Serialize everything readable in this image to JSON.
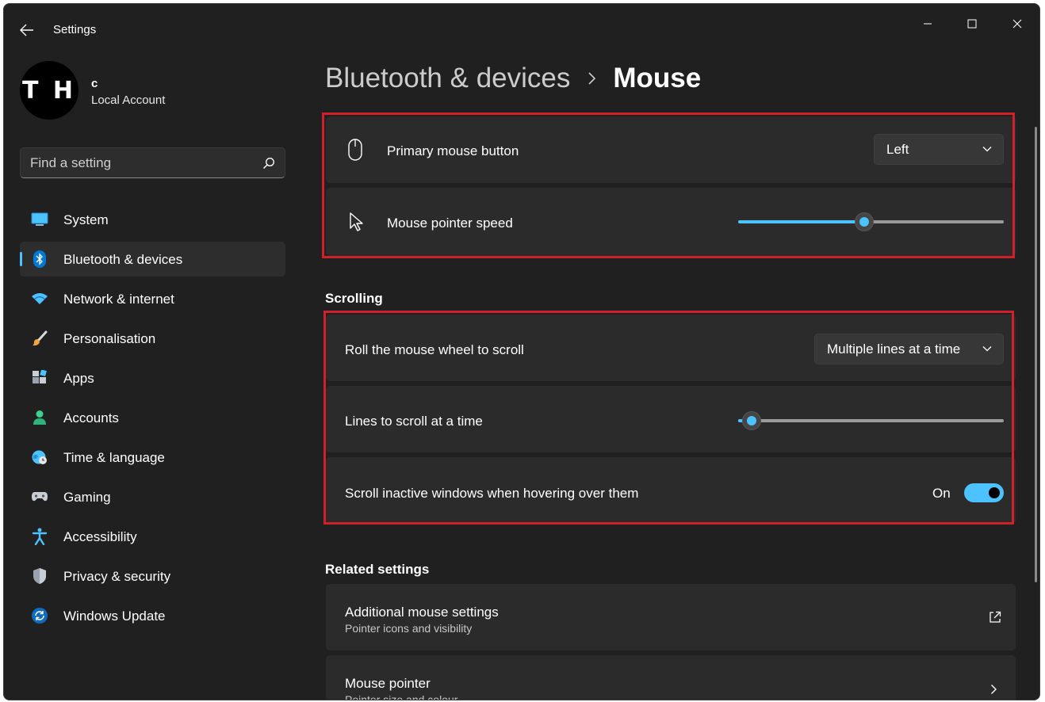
{
  "window": {
    "title": "Settings"
  },
  "profile": {
    "initials": "T H",
    "name": "c",
    "account_type": "Local Account"
  },
  "search": {
    "placeholder": "Find a setting"
  },
  "nav": {
    "items": [
      {
        "label": "System",
        "icon": "monitor-icon"
      },
      {
        "label": "Bluetooth & devices",
        "icon": "bluetooth-icon",
        "active": true
      },
      {
        "label": "Network & internet",
        "icon": "wifi-icon"
      },
      {
        "label": "Personalisation",
        "icon": "paintbrush-icon"
      },
      {
        "label": "Apps",
        "icon": "apps-icon"
      },
      {
        "label": "Accounts",
        "icon": "person-icon"
      },
      {
        "label": "Time & language",
        "icon": "globe-clock-icon"
      },
      {
        "label": "Gaming",
        "icon": "gamepad-icon"
      },
      {
        "label": "Accessibility",
        "icon": "accessibility-icon"
      },
      {
        "label": "Privacy & security",
        "icon": "shield-icon"
      },
      {
        "label": "Windows Update",
        "icon": "update-icon"
      }
    ]
  },
  "header": {
    "parent": "Bluetooth & devices",
    "current": "Mouse"
  },
  "mouse": {
    "primary_button": {
      "label": "Primary mouse button",
      "value": "Left"
    },
    "pointer_speed": {
      "label": "Mouse pointer speed",
      "fraction": 0.475
    }
  },
  "scrolling": {
    "title": "Scrolling",
    "roll_wheel": {
      "label": "Roll the mouse wheel to scroll",
      "value": "Multiple lines at a time"
    },
    "lines": {
      "label": "Lines to scroll at a time",
      "fraction": 0.05
    },
    "inactive": {
      "label": "Scroll inactive windows when hovering over them",
      "state": "On"
    }
  },
  "related": {
    "title": "Related settings",
    "additional": {
      "label": "Additional mouse settings",
      "sub": "Pointer icons and visibility"
    },
    "pointer": {
      "label": "Mouse pointer",
      "sub": "Pointer size and colour"
    }
  },
  "colors": {
    "accent": "#4cc2ff",
    "highlight": "#d0202a",
    "background": "#202020",
    "card": "#2b2b2b"
  }
}
